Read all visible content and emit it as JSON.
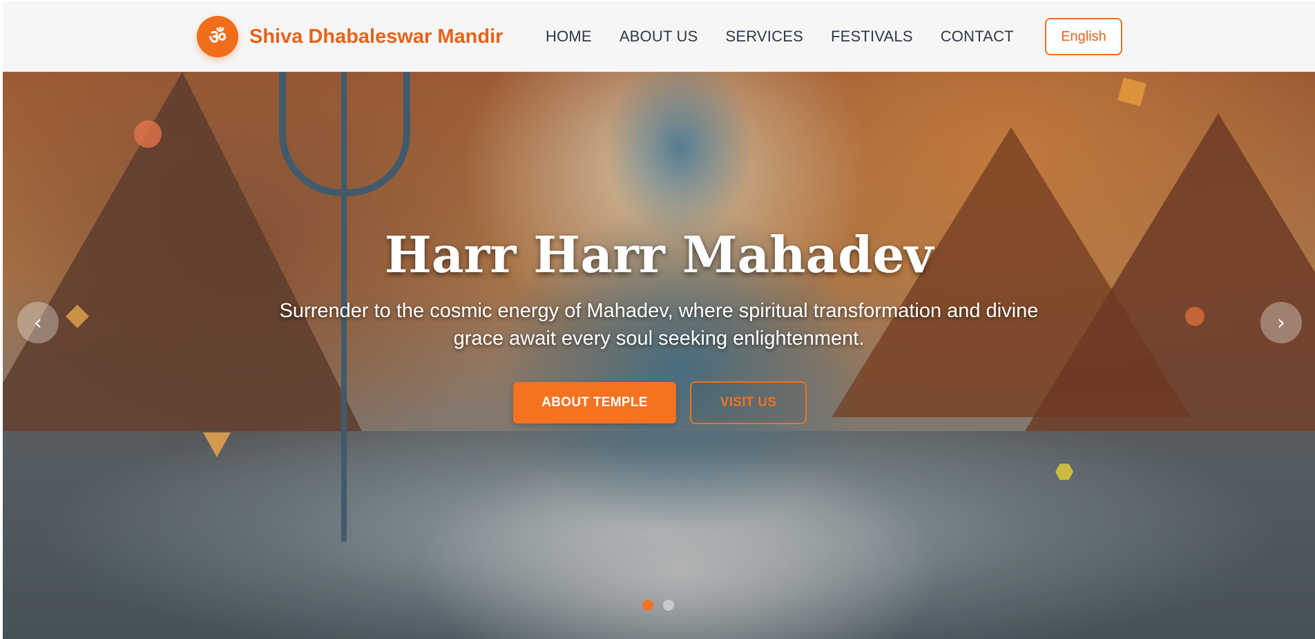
{
  "brand": {
    "logo_symbol": "ॐ",
    "name": "Shiva Dhabaleswar Mandir",
    "accent_color": "#f06d1a"
  },
  "nav": {
    "items": [
      {
        "label": "HOME"
      },
      {
        "label": "ABOUT US"
      },
      {
        "label": "SERVICES"
      },
      {
        "label": "FESTIVALS"
      },
      {
        "label": "CONTACT"
      }
    ],
    "language_button": "English"
  },
  "hero": {
    "title": "Harr Harr Mahadev",
    "subtitle": "Surrender to the cosmic energy of Mahadev, where spiritual transformation and divine grace await every soul seeking enlightenment.",
    "primary_button": "ABOUT TEMPLE",
    "secondary_button": "VISIT US",
    "prev_icon": "‹",
    "next_icon": "›",
    "slides": [
      {
        "active": true
      },
      {
        "active": false
      }
    ]
  },
  "colors": {
    "primary_orange": "#f57320",
    "nav_text": "#2f3747",
    "header_bg": "#f6f6f6"
  }
}
